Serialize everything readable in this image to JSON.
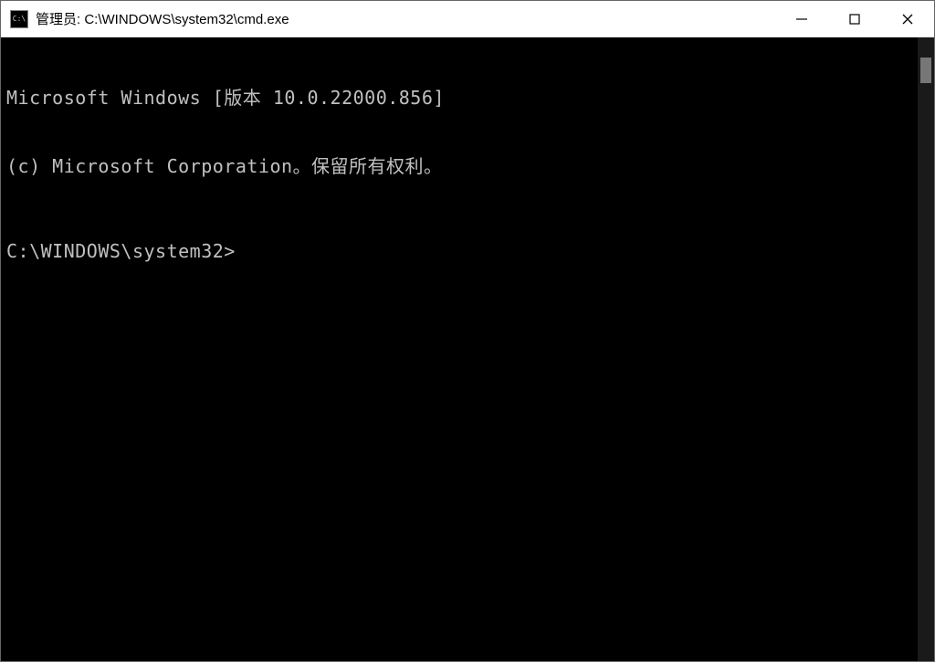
{
  "window": {
    "title": "管理员: C:\\WINDOWS\\system32\\cmd.exe",
    "icon_label": "cmd"
  },
  "terminal": {
    "line1": "Microsoft Windows [版本 10.0.22000.856]",
    "line2": "(c) Microsoft Corporation。保留所有权利。",
    "prompt": "C:\\WINDOWS\\system32>"
  }
}
